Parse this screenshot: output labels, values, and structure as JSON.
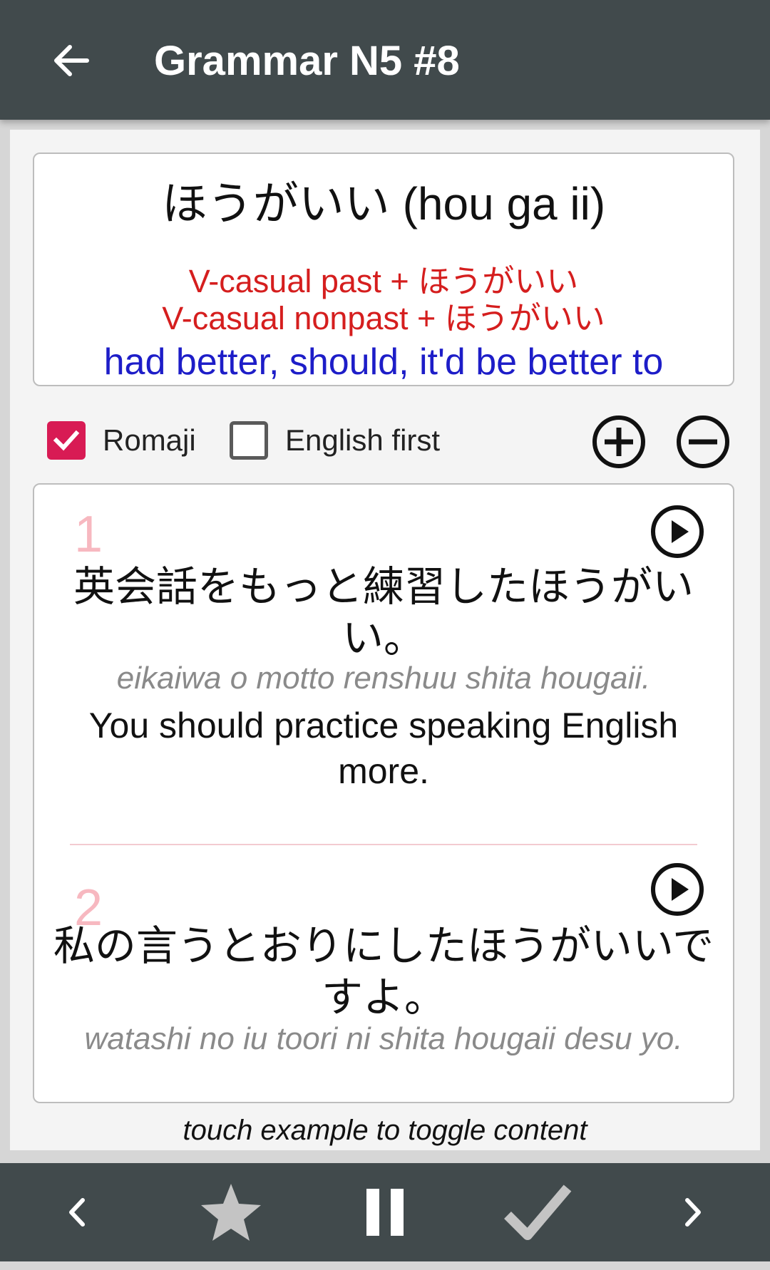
{
  "appbar": {
    "title": "Grammar N5 #8",
    "back_icon": "arrow-left-icon"
  },
  "grammar": {
    "title": "ほうがいい (hou ga ii)",
    "forms": [
      "V-casual past + ほうがいい",
      "V-casual nonpast + ほうがいい"
    ],
    "meaning": "had better, should, it'd be better to"
  },
  "options": {
    "romaji": {
      "label": "Romaji",
      "checked": true
    },
    "english_first": {
      "label": "English first",
      "checked": false
    },
    "zoom_in_icon": "plus-circle-icon",
    "zoom_out_icon": "minus-circle-icon"
  },
  "examples": [
    {
      "number": "1",
      "japanese": "英会話をもっと練習したほうがいい。",
      "romaji": "eikaiwa o motto renshuu shita hougaii.",
      "english": "You should practice speaking English more."
    },
    {
      "number": "2",
      "japanese": "私の言うとおりにしたほうがいいですよ。",
      "romaji": "watashi no iu toori ni shita hougaii desu yo."
    }
  ],
  "hint": "touch example to toggle content",
  "bottom_bar": [
    "chevron-left-icon",
    "star-icon",
    "pause-icon",
    "check-icon",
    "chevron-right-icon"
  ],
  "colors": {
    "appbar": "#414a4c",
    "accent_checkbox": "#d81b54",
    "form_red": "#d51e1e",
    "meaning_blue": "#1d1dc8",
    "example_number": "#f7b8c0"
  }
}
